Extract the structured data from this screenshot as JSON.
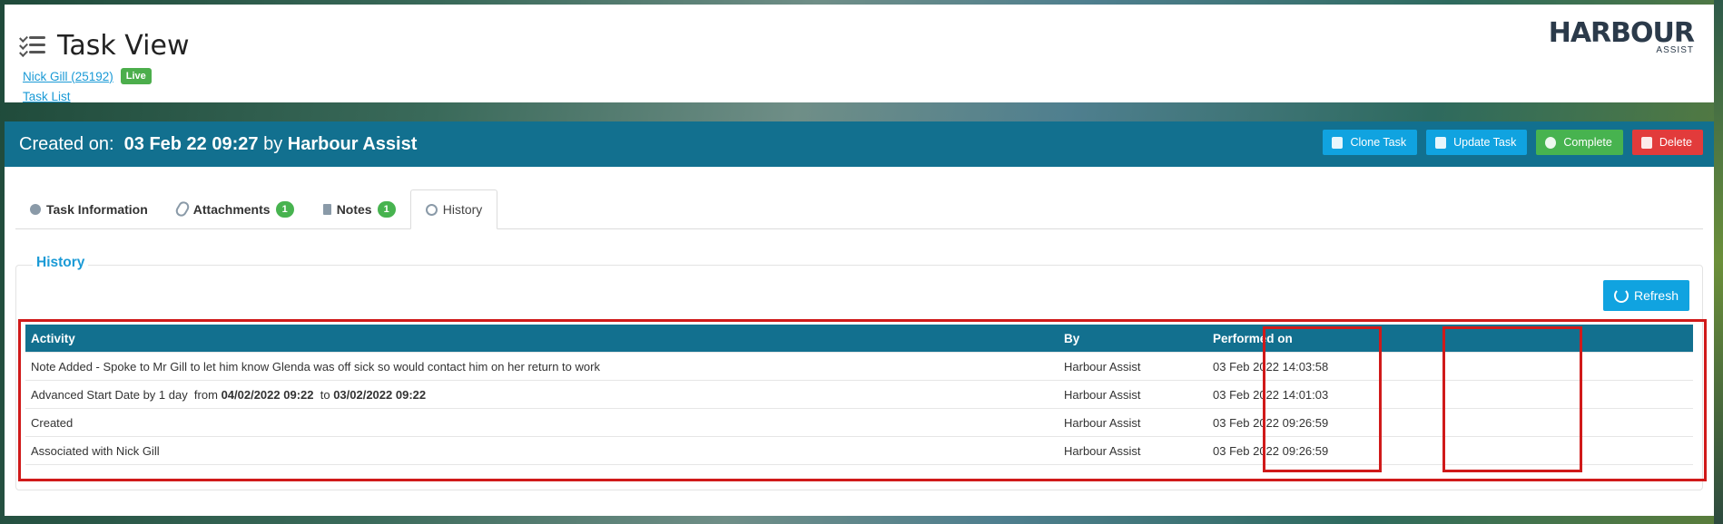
{
  "header": {
    "title": "Task View",
    "person_link": "Nick Gill (25192)",
    "status_badge": "Live",
    "task_list_link": "Task List",
    "logo_main": "HARBOUR",
    "logo_sub": "ASSIST"
  },
  "bar": {
    "created_label": "Created on:",
    "created_date": "03 Feb 22 09:27",
    "by_label": "by",
    "created_by": "Harbour Assist",
    "buttons": {
      "clone": "Clone Task",
      "update": "Update Task",
      "complete": "Complete",
      "delete": "Delete"
    }
  },
  "tabs": [
    {
      "label": "Task Information"
    },
    {
      "label": "Attachments",
      "count": "1"
    },
    {
      "label": "Notes",
      "count": "1"
    },
    {
      "label": "History"
    }
  ],
  "history": {
    "legend": "History",
    "refresh_label": "Refresh",
    "columns": [
      "Activity",
      "By",
      "Performed on"
    ],
    "rows": [
      {
        "activity": "Note Added - Spoke to Mr Gill to let him know Glenda was off sick so would contact him on her return to work",
        "by": "Harbour Assist",
        "performed": "03 Feb 2022 14:03:58"
      },
      {
        "activity_prefix": "Advanced Start Date by 1 day  from ",
        "activity_from": "04/02/2022 09:22",
        "activity_mid": "  to ",
        "activity_to": "03/02/2022 09:22",
        "by": "Harbour Assist",
        "performed": "03 Feb 2022 14:01:03"
      },
      {
        "activity": "Created",
        "by": "Harbour Assist",
        "performed": "03 Feb 2022 09:26:59"
      },
      {
        "activity": "Associated with Nick Gill",
        "by": "Harbour Assist",
        "performed": "03 Feb 2022 09:26:59"
      }
    ]
  },
  "colors": {
    "primary_bar": "#12708f",
    "accent_blue": "#10a3e0",
    "success_green": "#47b34f",
    "danger_red": "#e23b3b",
    "highlight_red": "#d01a1a"
  }
}
